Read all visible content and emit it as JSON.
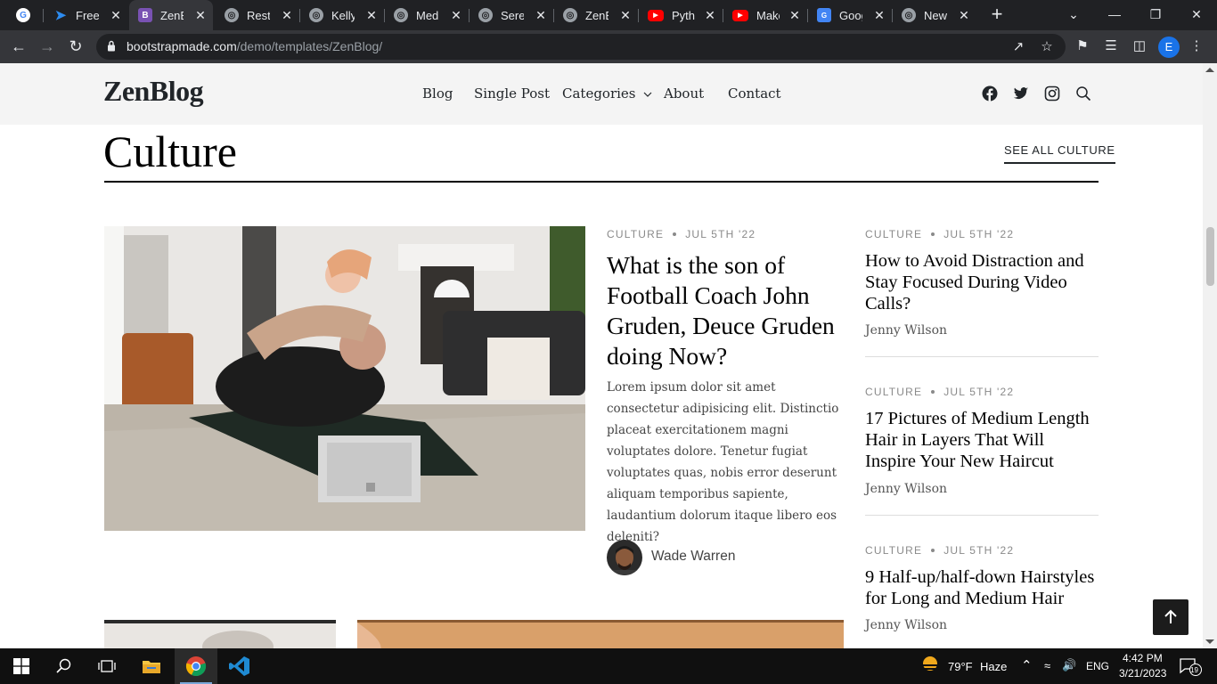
{
  "browser": {
    "tabs": [
      {
        "title": "",
        "icon": "google-icon"
      },
      {
        "title": "Free B",
        "icon": "bootstrapmade-icon"
      },
      {
        "title": "ZenBl",
        "icon": "bootstrap-icon"
      },
      {
        "title": "Restau",
        "icon": "globe-icon"
      },
      {
        "title": "Kelly E",
        "icon": "globe-icon"
      },
      {
        "title": "Medic",
        "icon": "globe-icon"
      },
      {
        "title": "Seren",
        "icon": "globe-icon"
      },
      {
        "title": "ZenBl",
        "icon": "globe-icon"
      },
      {
        "title": "Pytho",
        "icon": "youtube-icon"
      },
      {
        "title": "Make",
        "icon": "youtube-icon"
      },
      {
        "title": "Googl",
        "icon": "google-news-icon"
      },
      {
        "title": "New T",
        "icon": "globe-icon"
      }
    ],
    "url_host": "bootstrapmade.com",
    "url_path": "/demo/templates/ZenBlog/",
    "profile_initial": "E",
    "new_tab": "+"
  },
  "site": {
    "logo": "ZenBlog",
    "nav": {
      "blog": "Blog",
      "single_post": "Single Post",
      "categories": "Categories",
      "about": "About",
      "contact": "Contact"
    }
  },
  "section": {
    "title": "Culture",
    "see_all": "SEE ALL CULTURE"
  },
  "featured": {
    "category": "CULTURE",
    "date": "JUL 5TH '22",
    "title": "What is the son of Football Coach John Gruden, Deuce Gruden doing Now?",
    "excerpt": "Lorem ipsum dolor sit amet consectetur adipisicing elit. Distinctio placeat exercitationem magni voluptates dolore. Tenetur fugiat voluptates quas, nobis error deserunt aliquam temporibus sapiente, laudantium dolorum itaque libero eos deleniti?",
    "author": "Wade Warren"
  },
  "side_posts": [
    {
      "category": "CULTURE",
      "date": "JUL 5TH '22",
      "title": "How to Avoid Distraction and Stay Focused During Video Calls?",
      "author": "Jenny Wilson"
    },
    {
      "category": "CULTURE",
      "date": "JUL 5TH '22",
      "title": "17 Pictures of Medium Length Hair in Layers That Will Inspire Your New Haircut",
      "author": "Jenny Wilson"
    },
    {
      "category": "CULTURE",
      "date": "JUL 5TH '22",
      "title": "9 Half-up/half-down Hairstyles for Long and Medium Hair",
      "author": "Jenny Wilson"
    }
  ],
  "taskbar": {
    "weather_temp": "79°F",
    "weather_cond": "Haze",
    "language": "ENG",
    "time": "4:42 PM",
    "date": "3/21/2023",
    "notifications": "19"
  },
  "colors": {
    "chrome_dark": "#202124",
    "chrome_toolbar": "#35363a",
    "header_bg": "#f4f4f4",
    "accent_dark": "#1c1c1c"
  }
}
